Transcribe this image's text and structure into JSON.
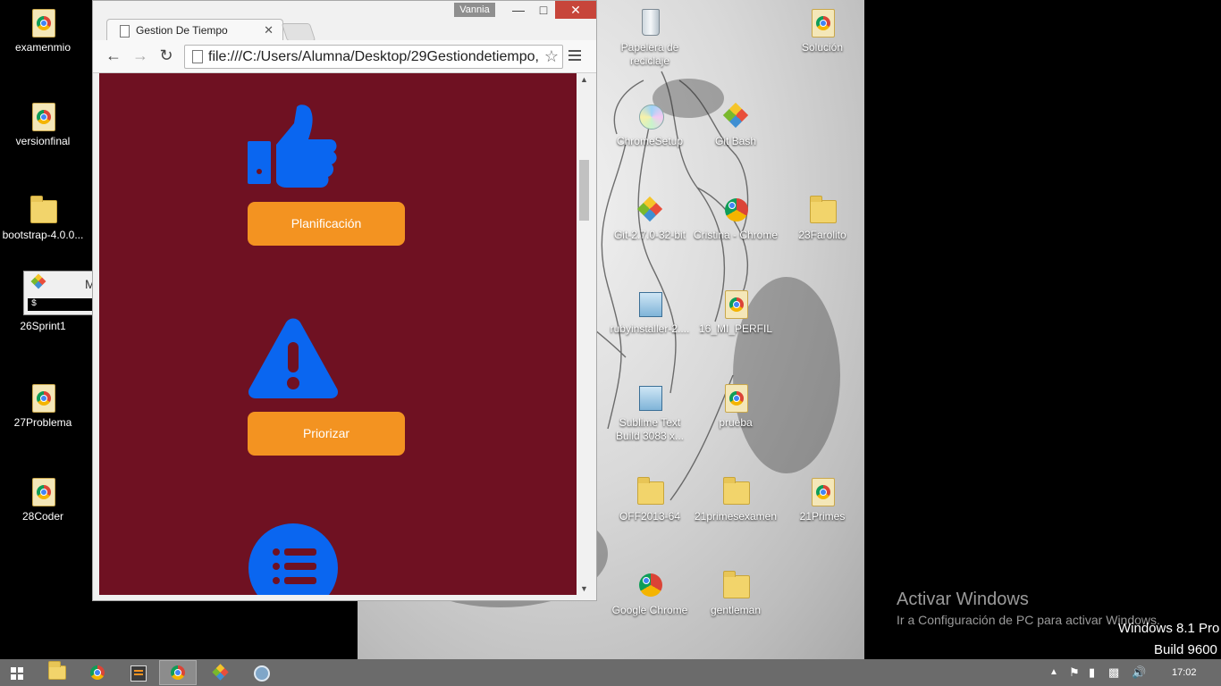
{
  "desktop": {
    "left_icons": [
      {
        "label": "examenmio",
        "kind": "chrome-file"
      },
      {
        "label": "versionfinal",
        "kind": "chrome-file"
      },
      {
        "label": "bootstrap-4.0.0...",
        "kind": "folder-zip"
      },
      {
        "label": "26Sprint1",
        "kind": "git-bash-window"
      },
      {
        "label": "27Problema",
        "kind": "chrome-file"
      },
      {
        "label": "28Coder",
        "kind": "chrome-file"
      }
    ],
    "mini_window": {
      "letter": "M",
      "prompt": "$"
    },
    "grid_icons": [
      {
        "label": "Papelera de reciclaje",
        "kind": "recycle-bin"
      },
      {
        "label": "Solución",
        "kind": "chrome-file"
      },
      {
        "label": "ChromeSetup",
        "kind": "installer-cd"
      },
      {
        "label": "Git Bash",
        "kind": "git"
      },
      {
        "label": "Git-2.7.0-32-bit",
        "kind": "git"
      },
      {
        "label": "Cristina - Chrome",
        "kind": "chrome-shortcut"
      },
      {
        "label": "23Farolito",
        "kind": "folder"
      },
      {
        "label": "rubyinstaller-2....",
        "kind": "installer"
      },
      {
        "label": "16_MI_PERFIL",
        "kind": "chrome-file"
      },
      {
        "label": "Sublime Text Build 3083 x...",
        "kind": "installer"
      },
      {
        "label": "prueba",
        "kind": "chrome-file"
      },
      {
        "label": "OFF2013-64",
        "kind": "folder"
      },
      {
        "label": "21primesexamen",
        "kind": "folder"
      },
      {
        "label": "21Primes",
        "kind": "chrome-file"
      },
      {
        "label": "Google Chrome",
        "kind": "chrome-shortcut"
      },
      {
        "label": "gentleman",
        "kind": "folder-zip"
      }
    ],
    "activation": {
      "title": "Activar Windows",
      "subtitle": "Ir a Configuración de PC para activar Windows."
    },
    "os_version": {
      "line1": "Windows 8.1 Pro",
      "line2": "Build 9600"
    }
  },
  "browser": {
    "user_badge": "Vannia",
    "tab_title": "Gestion De Tiempo",
    "url": "file:///C:/Users/Alumna/Desktop/29Gestiondetiempo,",
    "page": {
      "bg_color": "#6f1122",
      "accent_color": "#f39321",
      "icon_color": "#0a66f0",
      "buttons": [
        {
          "label": "Planificación",
          "icon": "thumbs-up-icon"
        },
        {
          "label": "Priorizar",
          "icon": "warning-icon"
        }
      ],
      "third_icon": "list-icon"
    }
  },
  "taskbar": {
    "apps": [
      "file-explorer",
      "chrome",
      "sublime-text",
      "chrome-active",
      "git",
      "settings"
    ],
    "clock": "17:02"
  }
}
